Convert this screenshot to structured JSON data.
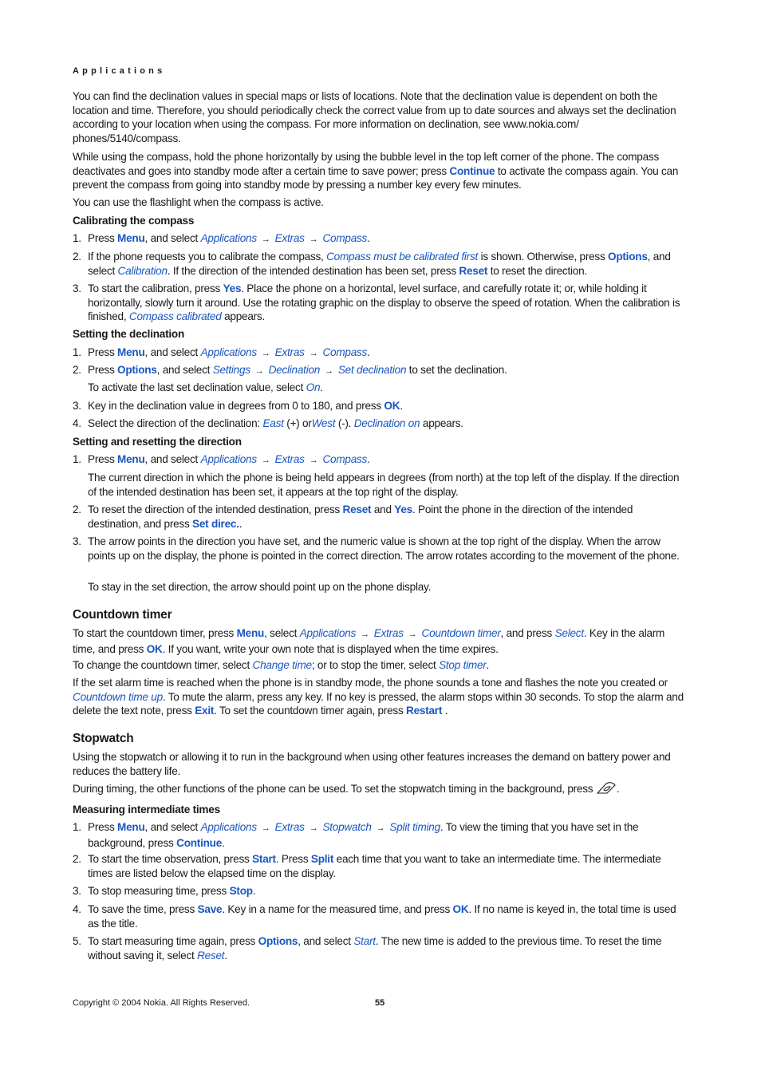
{
  "running_head": "Applications",
  "paragraphs": {
    "p1": [
      {
        "t": "You can find the declination values in special maps or lists of locations. Note that the declination value is dependent on both the location and time. Therefore, you should periodically check the correct value from up to date sources and always set the declination according to your location when using the compass. For more information on declination, see www.nokia.com/ phones/5140/compass."
      }
    ],
    "p2": [
      {
        "t": "While using the compass, hold the phone horizontally by using the bubble level in the top left corner of the phone. The compass deactivates and goes into standby mode after a certain time to save power; press "
      },
      {
        "t": "Continue",
        "s": "b"
      },
      {
        "t": " to activate the compass again. You can prevent the compass from going into standby mode by pressing a number key every few minutes."
      }
    ],
    "p3": [
      {
        "t": "You can use the flashlight when the compass is active."
      }
    ]
  },
  "calibrating": {
    "title": "Calibrating the compass",
    "items": [
      [
        {
          "t": "Press "
        },
        {
          "t": "Menu",
          "s": "b"
        },
        {
          "t": ", and select "
        },
        {
          "t": "Applications",
          "s": "i"
        },
        {
          "t": "→",
          "s": "ar"
        },
        {
          "t": "Extras",
          "s": "i"
        },
        {
          "t": "→",
          "s": "ar"
        },
        {
          "t": "Compass",
          "s": "i"
        },
        {
          "t": "."
        }
      ],
      [
        {
          "t": "If the phone requests you to calibrate the compass, "
        },
        {
          "t": "Compass must be calibrated first",
          "s": "i"
        },
        {
          "t": " is shown. Otherwise, press "
        },
        {
          "t": "Options",
          "s": "b"
        },
        {
          "t": ", and select "
        },
        {
          "t": "Calibration",
          "s": "i"
        },
        {
          "t": ". If the direction of the intended destination has been set, press "
        },
        {
          "t": "Reset",
          "s": "b"
        },
        {
          "t": " to reset the direction."
        }
      ],
      [
        {
          "t": "To start the calibration, press "
        },
        {
          "t": "Yes",
          "s": "b"
        },
        {
          "t": ". Place the phone on a horizontal, level surface, and carefully rotate it; or, while holding it horizontally, slowly turn it around. Use the rotating graphic on the display to observe the speed of rotation. When the calibration is finished, "
        },
        {
          "t": "Compass calibrated",
          "s": "i"
        },
        {
          "t": " appears."
        }
      ]
    ]
  },
  "declination": {
    "title": "Setting the declination",
    "items": [
      [
        {
          "t": "Press "
        },
        {
          "t": "Menu",
          "s": "b"
        },
        {
          "t": ", and select "
        },
        {
          "t": "Applications",
          "s": "i"
        },
        {
          "t": "→",
          "s": "ar"
        },
        {
          "t": "Extras",
          "s": "i"
        },
        {
          "t": "→",
          "s": "ar"
        },
        {
          "t": "Compass",
          "s": "i"
        },
        {
          "t": "."
        }
      ],
      [
        {
          "t": "Press "
        },
        {
          "t": "Options",
          "s": "b"
        },
        {
          "t": ", and select "
        },
        {
          "t": "Settings",
          "s": "i"
        },
        {
          "t": "→",
          "s": "ar"
        },
        {
          "t": "Declination",
          "s": "i"
        },
        {
          "t": "→",
          "s": "ar"
        },
        {
          "t": "Set declination",
          "s": "i"
        },
        {
          "t": " to set the declination."
        }
      ],
      [
        {
          "t": "To activate the last set declination value, select "
        },
        {
          "t": "On",
          "s": "i"
        },
        {
          "t": "."
        }
      ],
      [
        {
          "t": "Key in the declination value in degrees from 0 to 180, and press "
        },
        {
          "t": "OK",
          "s": "b"
        },
        {
          "t": "."
        }
      ],
      [
        {
          "t": "Select the direction of the declination: "
        },
        {
          "t": "East",
          "s": "i"
        },
        {
          "t": " (+) or"
        },
        {
          "t": "West",
          "s": "i"
        },
        {
          "t": " (-). "
        },
        {
          "t": "Declination on",
          "s": "i"
        },
        {
          "t": " appears."
        }
      ]
    ]
  },
  "direction": {
    "title": "Setting and resetting the direction",
    "items": [
      [
        {
          "t": "Press "
        },
        {
          "t": "Menu",
          "s": "b"
        },
        {
          "t": ", and select "
        },
        {
          "t": "Applications",
          "s": "i"
        },
        {
          "t": "→",
          "s": "ar"
        },
        {
          "t": "Extras",
          "s": "i"
        },
        {
          "t": "→",
          "s": "ar"
        },
        {
          "t": "Compass",
          "s": "i"
        },
        {
          "t": "."
        }
      ],
      [
        {
          "t": "The current direction in which the phone is being held appears in degrees (from north) at the top left of the display. If the direction of the intended destination has been set, it appears at the top right of the display."
        }
      ],
      [
        {
          "t": "To reset the direction of the intended destination, press "
        },
        {
          "t": "Reset",
          "s": "b"
        },
        {
          "t": " and "
        },
        {
          "t": "Yes",
          "s": "b"
        },
        {
          "t": ". Point the phone in the direction of the intended destination, and press "
        },
        {
          "t": "Set direc.",
          "s": "b"
        },
        {
          "t": "."
        }
      ],
      [
        {
          "t": "The arrow points in the direction you have set, and the numeric value is shown at the top right of the display. When the arrow points up on the display, the phone is pointed in the correct direction. The arrow rotates according to the movement of the phone."
        }
      ],
      [
        {
          "t": "To stay in the set direction, the arrow should point up on the phone display."
        }
      ]
    ]
  },
  "countdown": {
    "title": "Countdown timer",
    "p1": [
      {
        "t": "To start the countdown timer, press "
      },
      {
        "t": "Menu",
        "s": "b"
      },
      {
        "t": ", select "
      },
      {
        "t": "Applications",
        "s": "i"
      },
      {
        "t": "→",
        "s": "ar"
      },
      {
        "t": "Extras",
        "s": "i"
      },
      {
        "t": "→",
        "s": "ar"
      },
      {
        "t": "Countdown timer",
        "s": "i"
      },
      {
        "t": ", and press "
      },
      {
        "t": "Select",
        "s": "i"
      },
      {
        "t": ". Key in the alarm time, and press "
      },
      {
        "t": "OK",
        "s": "b"
      },
      {
        "t": ". If you want, write your own note that is displayed when the time expires."
      }
    ],
    "p2": [
      {
        "t": "To change the countdown timer, select "
      },
      {
        "t": "Change time",
        "s": "i"
      },
      {
        "t": "; or to stop the timer, select "
      },
      {
        "t": "Stop timer",
        "s": "i"
      },
      {
        "t": "."
      }
    ],
    "p3": [
      {
        "t": "If the set alarm time is reached when the phone is in standby mode, the phone sounds a tone and flashes the note you created or "
      },
      {
        "t": "Countdown time up",
        "s": "i"
      },
      {
        "t": ". To mute the alarm, press any key. If no key is pressed, the alarm stops within 30 seconds. To stop the alarm and delete the text note, press "
      },
      {
        "t": "Exit",
        "s": "b"
      },
      {
        "t": ". To set the countdown timer again, press "
      },
      {
        "t": "Restart",
        "s": "b"
      },
      {
        "t": " ."
      }
    ]
  },
  "stopwatch": {
    "title": "Stopwatch",
    "p1": [
      {
        "t": "Using the stopwatch or allowing it to run in the background when using other features increases the demand on battery power and reduces the battery life."
      }
    ],
    "p2": [
      {
        "t": "During timing, the other functions of the phone can be used. To set the stopwatch timing in the background, press "
      },
      {
        "t": "end-key-icon",
        "s": "icon"
      },
      {
        "t": "."
      }
    ],
    "sub_title": "Measuring intermediate times",
    "items": [
      [
        {
          "t": "Press "
        },
        {
          "t": "Menu",
          "s": "b"
        },
        {
          "t": ", and select "
        },
        {
          "t": "Applications",
          "s": "i"
        },
        {
          "t": "→",
          "s": "ar"
        },
        {
          "t": "Extras",
          "s": "i"
        },
        {
          "t": "→",
          "s": "ar"
        },
        {
          "t": "Stopwatch",
          "s": "i"
        },
        {
          "t": "→",
          "s": "ar"
        },
        {
          "t": "Split timing",
          "s": "i"
        },
        {
          "t": ". To view the timing that you have set in the background, press "
        },
        {
          "t": "Continue",
          "s": "b"
        },
        {
          "t": "."
        }
      ],
      [
        {
          "t": "To start the time observation, press "
        },
        {
          "t": "Start",
          "s": "b"
        },
        {
          "t": ". Press "
        },
        {
          "t": "Split",
          "s": "b"
        },
        {
          "t": " each time that you want to take an intermediate time. The intermediate times are listed below the elapsed time on the display."
        }
      ],
      [
        {
          "t": "To stop measuring time, press "
        },
        {
          "t": "Stop",
          "s": "b"
        },
        {
          "t": "."
        }
      ],
      [
        {
          "t": "To save the time, press "
        },
        {
          "t": "Save",
          "s": "b"
        },
        {
          "t": ". Key in a name for the measured time, and press "
        },
        {
          "t": "OK",
          "s": "b"
        },
        {
          "t": ". If no name is keyed in, the total time is used as the title."
        }
      ],
      [
        {
          "t": "To start measuring time again, press "
        },
        {
          "t": "Options",
          "s": "b"
        },
        {
          "t": ", and select "
        },
        {
          "t": "Start",
          "s": "i"
        },
        {
          "t": ". The new time is added to the previous time. To reset the time without saving it, select "
        },
        {
          "t": "Reset",
          "s": "i"
        },
        {
          "t": "."
        }
      ]
    ]
  },
  "footer": {
    "copyright": "Copyright © 2004 Nokia. All Rights Reserved.",
    "page_number": "55"
  },
  "colors": {
    "accent": "#1a56c0",
    "text": "#1a1a1a"
  }
}
